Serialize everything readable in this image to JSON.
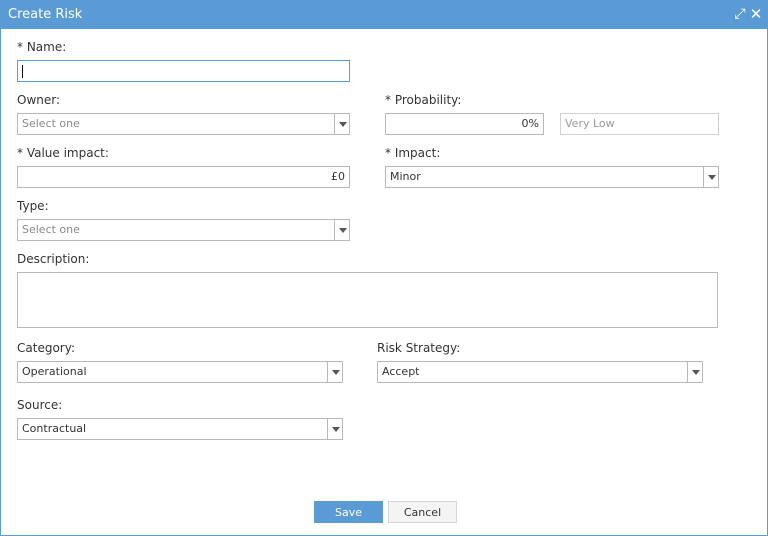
{
  "window": {
    "title": "Create Risk"
  },
  "form": {
    "name": {
      "label": "* Name:",
      "value": ""
    },
    "owner": {
      "label": "Owner:",
      "value": "Select one"
    },
    "probability": {
      "label": "* Probability:",
      "value": "0%",
      "level": "Very Low"
    },
    "value_impact": {
      "label": "* Value impact:",
      "value": "£0"
    },
    "impact": {
      "label": "* Impact:",
      "value": "Minor"
    },
    "type": {
      "label": "Type:",
      "value": "Select one"
    },
    "description": {
      "label": "Description:",
      "value": ""
    },
    "category": {
      "label": "Category:",
      "value": "Operational"
    },
    "risk_strategy": {
      "label": "Risk Strategy:",
      "value": "Accept"
    },
    "source": {
      "label": "Source:",
      "value": "Contractual"
    }
  },
  "actions": {
    "save_label": "Save",
    "cancel_label": "Cancel"
  },
  "colors": {
    "accent": "#5b9bd5",
    "border": "#b8b8b8"
  },
  "icons": {
    "maximize": "expand-arrows-icon",
    "close": "close-icon"
  }
}
